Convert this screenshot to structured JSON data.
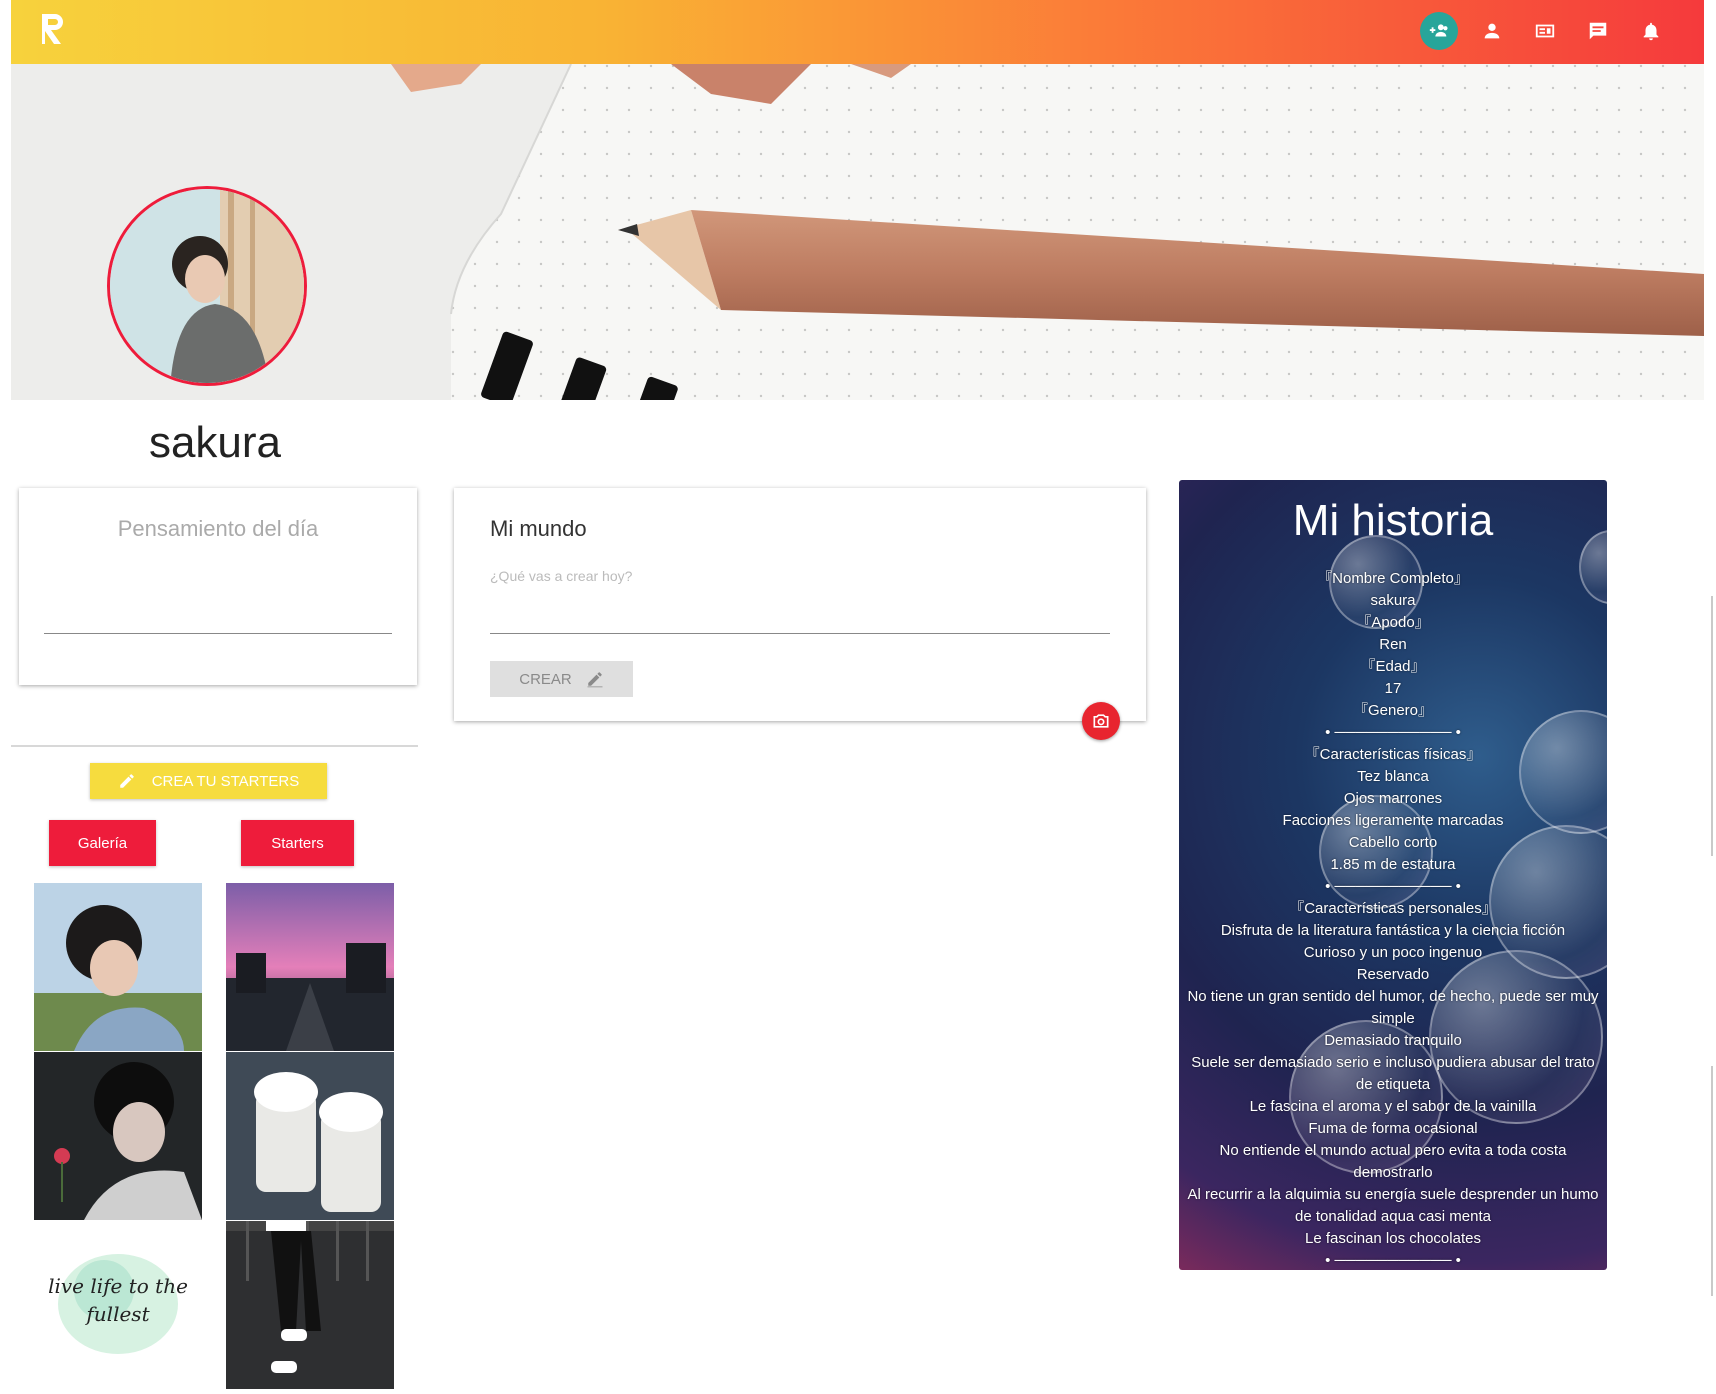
{
  "colors": {
    "accent_red": "#ee1c3b",
    "accent_yellow": "#f6dc3e",
    "active_icon_bg": "#27a59a"
  },
  "header": {
    "logo_icon": "logo-r-icon",
    "icons": [
      "add-friends-icon",
      "profile-icon",
      "feed-icon",
      "chat-icon",
      "bell-icon"
    ]
  },
  "profile": {
    "username": "sakura"
  },
  "thought": {
    "title": "Pensamiento del día"
  },
  "world": {
    "title": "Mi mundo",
    "placeholder": "¿Qué vas a crear hoy?",
    "create_label": "CREAR"
  },
  "starters": {
    "create_label": "CREA TU STARTERS",
    "tabs": [
      "Galería",
      "Starters"
    ],
    "quote": "live life to the fullest"
  },
  "story": {
    "title": "Mi historia",
    "lines": [
      "『Nombre Completo』",
      "sakura",
      "『Apodo』",
      "Ren",
      "『Edad』",
      "17",
      "『Genero』",
      "• ─────────── •",
      "『Características físicas』",
      "Tez blanca",
      "Ojos marrones",
      "Facciones ligeramente marcadas",
      "Cabello corto",
      "1.85 m de estatura",
      "• ─────────── •",
      "『Características personales』",
      "Disfruta de la literatura fantástica y la ciencia ficción",
      "Curioso y un poco ingenuo",
      "Reservado",
      "No tiene un gran sentido del humor, de hecho, puede ser muy simple",
      "Demasiado tranquilo",
      "Suele ser demasiado serio e incluso pudiera abusar del trato de etiqueta",
      "Le fascina el aroma y el sabor de la vainilla",
      "Fuma de forma ocasional",
      "No entiende el mundo actual pero evita a toda costa demostrarlo",
      "Al recurrir a la alquimia su energía suele desprender un humo de tonalidad aqua casi menta",
      "Le fascinan los chocolates",
      "• ─────────── •"
    ]
  }
}
